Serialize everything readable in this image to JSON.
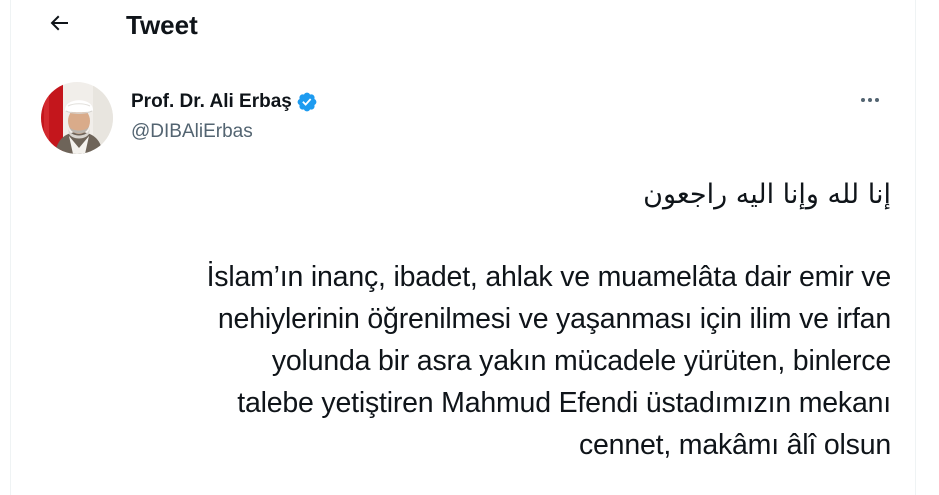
{
  "header": {
    "back_icon": "arrow-left-icon",
    "title": "Tweet"
  },
  "author": {
    "name": "Prof. Dr. Ali Erbaş",
    "handle": "@DIBAliErbas",
    "verified": true,
    "verified_icon": "verified-badge-icon",
    "avatar_icon": "avatar-photo"
  },
  "more_icon": "more-horizontal-icon",
  "tweet": {
    "arabic_line": "إنا لله وإنا اليه راجعون",
    "lines": [
      "İslam’ın inanç, ibadet, ahlak ve muamelâta dair emir ve",
      "nehiylerinin öğrenilmesi ve yaşanması için ilim ve irfan",
      "yolunda bir asra yakın mücadele yürüten, binlerce",
      "talebe yetiştiren Mahmud Efendi üstadımızın mekanı",
      "cennet, makâmı âlî olsun"
    ]
  },
  "colors": {
    "text_primary": "#0f1419",
    "text_secondary": "#536471",
    "verified_blue": "#1d9bf0",
    "border": "#eff3f4"
  }
}
